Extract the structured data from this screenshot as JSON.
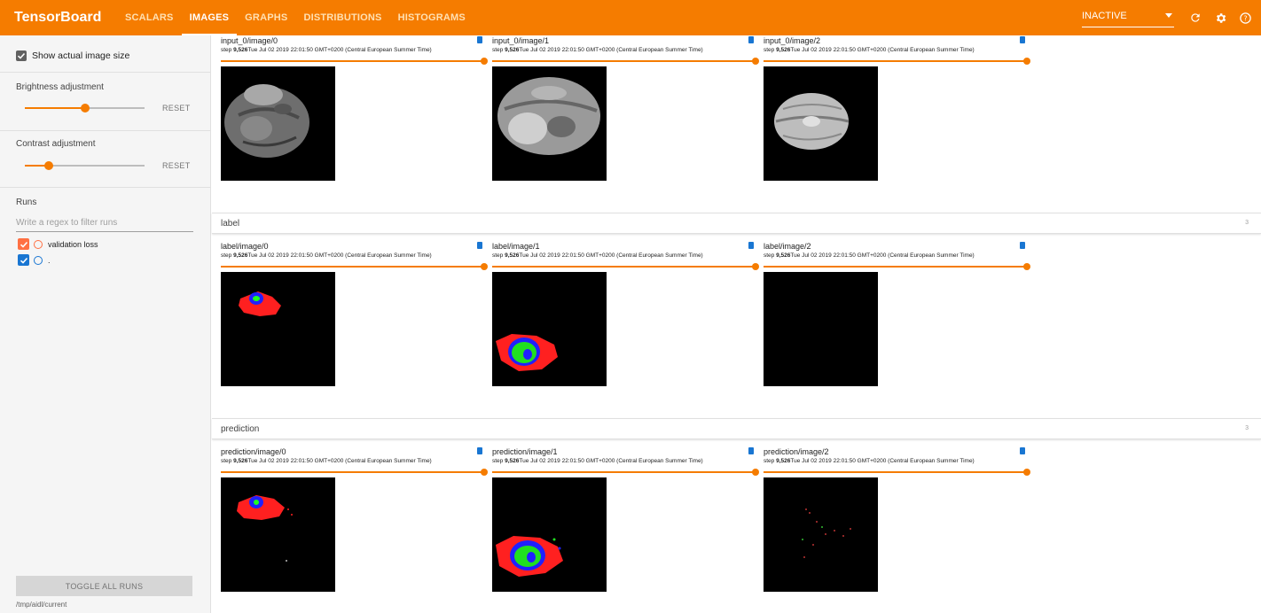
{
  "app": {
    "brand": "TensorBoard",
    "tabs": [
      {
        "label": "SCALARS",
        "active": false
      },
      {
        "label": "IMAGES",
        "active": true
      },
      {
        "label": "GRAPHS",
        "active": false
      },
      {
        "label": "DISTRIBUTIONS",
        "active": false
      },
      {
        "label": "HISTOGRAMS",
        "active": false
      }
    ],
    "inactive_select": "INACTIVE",
    "icons": [
      "refresh-icon",
      "settings-icon",
      "help-icon"
    ],
    "accent_color": "#f57c00"
  },
  "sidebar": {
    "show_actual_size": {
      "label": "Show actual image size",
      "checked": true
    },
    "brightness": {
      "label": "Brightness adjustment",
      "reset": "RESET",
      "value": 0.5
    },
    "contrast": {
      "label": "Contrast adjustment",
      "reset": "RESET",
      "value": 0.2
    },
    "runs_title": "Runs",
    "filter_placeholder": "Write a regex to filter runs",
    "runs": [
      {
        "name": "validation loss",
        "color": "#ff7043",
        "checked": true
      },
      {
        "name": ".",
        "color": "#1976d2",
        "checked": true
      }
    ],
    "toggle_all": "TOGGLE ALL RUNS",
    "logdir": "/tmp/aidl/current"
  },
  "groups": [
    {
      "name": "",
      "count": "",
      "cards": [
        {
          "title": "input_0/image/0",
          "step_label": "step",
          "step": "9,526",
          "time": "Tue Jul 02 2019 22:01:50 GMT+0200 (Central European Summer Time)",
          "kind": "brain-mri"
        },
        {
          "title": "input_0/image/1",
          "step_label": "step",
          "step": "9,526",
          "time": "Tue Jul 02 2019 22:01:50 GMT+0200 (Central European Summer Time)",
          "kind": "brain-mri"
        },
        {
          "title": "input_0/image/2",
          "step_label": "step",
          "step": "9,526",
          "time": "Tue Jul 02 2019 22:01:50 GMT+0200 (Central European Summer Time)",
          "kind": "brain-mri"
        }
      ]
    },
    {
      "name": "label",
      "count": "3",
      "cards": [
        {
          "title": "label/image/0",
          "step_label": "step",
          "step": "9,526",
          "time": "Tue Jul 02 2019 22:01:50 GMT+0200 (Central European Summer Time)",
          "kind": "segmentation"
        },
        {
          "title": "label/image/1",
          "step_label": "step",
          "step": "9,526",
          "time": "Tue Jul 02 2019 22:01:50 GMT+0200 (Central European Summer Time)",
          "kind": "segmentation"
        },
        {
          "title": "label/image/2",
          "step_label": "step",
          "step": "9,526",
          "time": "Tue Jul 02 2019 22:01:50 GMT+0200 (Central European Summer Time)",
          "kind": "segmentation-empty"
        }
      ]
    },
    {
      "name": "prediction",
      "count": "3",
      "cards": [
        {
          "title": "prediction/image/0",
          "step_label": "step",
          "step": "9,526",
          "time": "Tue Jul 02 2019 22:01:50 GMT+0200 (Central European Summer Time)",
          "kind": "segmentation"
        },
        {
          "title": "prediction/image/1",
          "step_label": "step",
          "step": "9,526",
          "time": "Tue Jul 02 2019 22:01:50 GMT+0200 (Central European Summer Time)",
          "kind": "segmentation"
        },
        {
          "title": "prediction/image/2",
          "step_label": "step",
          "step": "9,526",
          "time": "Tue Jul 02 2019 22:01:50 GMT+0200 (Central European Summer Time)",
          "kind": "segmentation-noise"
        }
      ]
    }
  ]
}
